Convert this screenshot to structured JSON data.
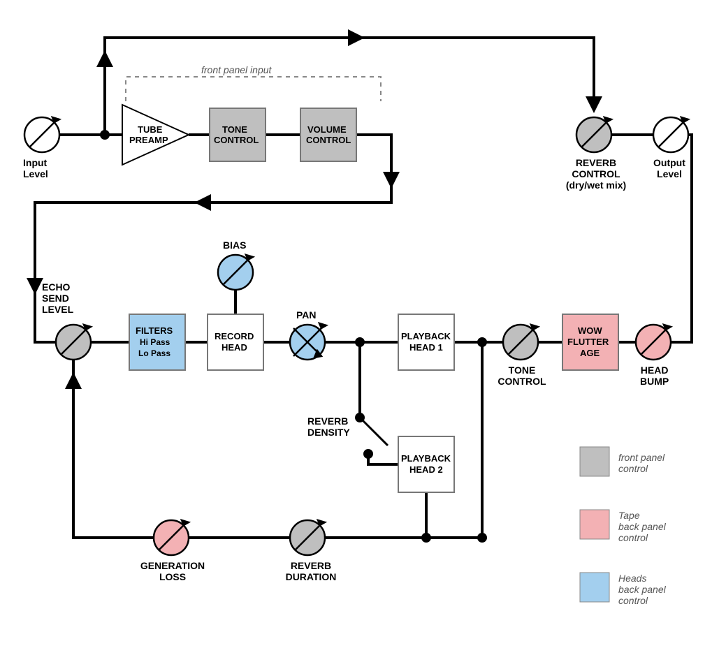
{
  "blocks": {
    "tube_preamp": "TUBE\nPREAMP",
    "tone_control_top": "TONE\nCONTROL",
    "volume_control": "VOLUME\nCONTROL",
    "filters": "FILTERS\nHi Pass\nLo Pass",
    "record_head": "RECORD\nHEAD",
    "playback_head_1": "PLAYBACK\nHEAD 1",
    "playback_head_2": "PLAYBACK\nHEAD 2",
    "wow_flutter_age": "WOW\nFLUTTER\nAGE"
  },
  "knobs": {
    "input_level": "Input\nLevel",
    "output_level": "Output\nLevel",
    "reverb_control": "REVERB\nCONTROL\n(dry/wet mix)",
    "echo_send_level": "ECHO\nSEND\nLEVEL",
    "bias": "BIAS",
    "pan": "PAN",
    "tone_control_right": "TONE\nCONTROL",
    "head_bump": "HEAD\nBUMP",
    "generation_loss": "GENERATION\nLOSS",
    "reverb_duration": "REVERB\nDURATION",
    "reverb_density": "REVERB\nDENSITY"
  },
  "notes": {
    "front_panel_input": "front panel input"
  },
  "legend": {
    "front_panel": "front panel\ncontrol",
    "tape_back_panel": "Tape\nback panel\ncontrol",
    "heads_back_panel": "Heads\nback panel\ncontrol"
  },
  "colors": {
    "grey": "#BFBFBF",
    "pink": "#F3B1B4",
    "blue": "#A3CFEE",
    "stroke": "#000",
    "box_stroke": "#777"
  }
}
